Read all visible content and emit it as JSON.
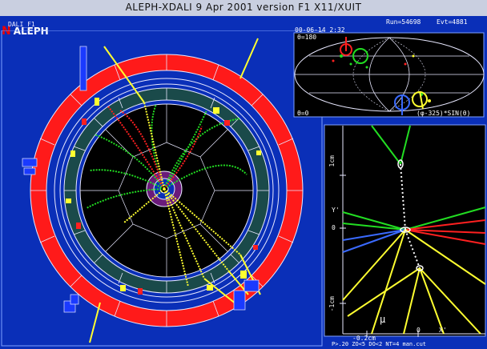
{
  "window": {
    "title": "ALEPH-XDALI  9 Apr 2001  version F1   X11/XUIT"
  },
  "logo": {
    "text": "ALEPH"
  },
  "header": {
    "run": "Run=54698",
    "event": "Evt=4881",
    "datetime": "00-06-14  2:32"
  },
  "main_panel": {
    "label": "DALI_F1"
  },
  "projection_panel": {
    "theta_top": "θ=180",
    "theta_bottom": "θ=0",
    "formula": "(φ-325)*SIN(θ)"
  },
  "vertex_panel": {
    "y_label": "Y'",
    "y_tick_top": "1cm",
    "y_tick_zero": "0",
    "y_tick_bottom": "-1cm",
    "x_tick_left": "-0.2cm",
    "x_tick_zero": "0",
    "x_label": "X'",
    "muon": "μ",
    "footer": "P>.20  ZO<5  DO<2  NT=4  man.cut"
  },
  "colors": {
    "background": "#0a2fb8",
    "calorimeter": "#ff1a1a",
    "hcal": "#1a4a4a",
    "track_green": "#22dd22",
    "track_red": "#ff2020",
    "track_yellow": "#ffff30"
  }
}
